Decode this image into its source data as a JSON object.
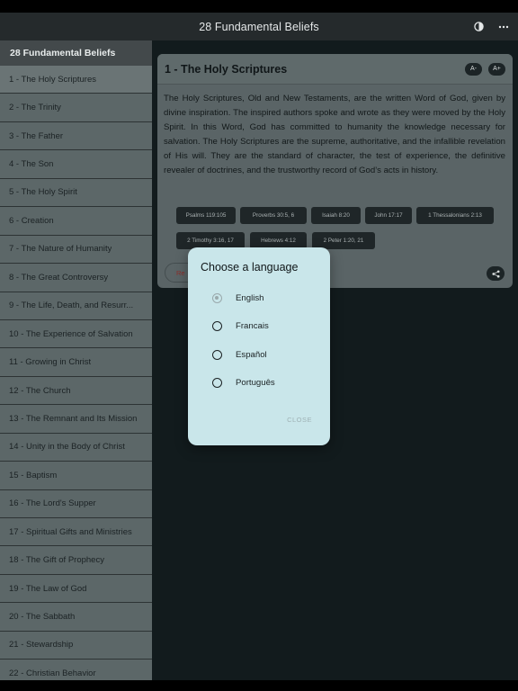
{
  "app_bar": {
    "title": "28 Fundamental Beliefs",
    "actions": [
      {
        "icon": "contrast-icon"
      },
      {
        "icon": "more-vert-icon"
      }
    ]
  },
  "sidebar": {
    "header": "28 Fundamental Beliefs",
    "items": [
      {
        "label": "1 - The Holy Scriptures"
      },
      {
        "label": "2 - The Trinity"
      },
      {
        "label": "3 - The Father"
      },
      {
        "label": "4 - The Son"
      },
      {
        "label": "5 - The Holy Spirit"
      },
      {
        "label": "6 - Creation"
      },
      {
        "label": "7 - The Nature of Humanity"
      },
      {
        "label": "8 - The Great Controversy"
      },
      {
        "label": "9 - The Life, Death, and Resurr..."
      },
      {
        "label": "10 - The Experience of Salvation"
      },
      {
        "label": "11 - Growing in Christ"
      },
      {
        "label": "12 - The Church"
      },
      {
        "label": "13 - The Remnant and Its Mission"
      },
      {
        "label": "14 - Unity in the Body of Christ"
      },
      {
        "label": "15 - Baptism"
      },
      {
        "label": "16 - The Lord's Supper"
      },
      {
        "label": "17 - Spiritual Gifts and Ministries"
      },
      {
        "label": "18 - The Gift of Prophecy"
      },
      {
        "label": "19 - The Law of God"
      },
      {
        "label": "20 - The Sabbath"
      },
      {
        "label": "21 - Stewardship"
      },
      {
        "label": "22 - Christian Behavior"
      }
    ]
  },
  "card": {
    "title": "1 - The Holy Scriptures",
    "font_decrease": "A-",
    "font_increase": "A+",
    "body": "The Holy Scriptures, Old and New Testaments, are the written Word of God, given by divine inspiration. The inspired authors spoke and wrote as they were moved by the Holy Spirit. In this Word, God has committed to humanity the knowledge necessary for salvation. The Holy Scriptures are the supreme, authoritative, and the infallible revelation of His will. They are the standard of character, the test of experience, the definitive revealer of doctrines, and the trustworthy record of God’s acts in history.",
    "references": [
      "Psalms 119:105",
      "Proverbs 30:5, 6",
      "Isaiah 8:20",
      "John 17:17",
      "1 Thessalonians 2:13",
      "2 Timothy 3:16, 17",
      "Hebrews 4:12",
      "2 Peter 1:20, 21"
    ],
    "read_button": "Re"
  },
  "dialog": {
    "title": "Choose a language",
    "options": [
      {
        "label": "English",
        "selected": true
      },
      {
        "label": "Francais",
        "selected": false
      },
      {
        "label": "Español",
        "selected": false
      },
      {
        "label": "Português",
        "selected": false
      }
    ],
    "close_label": "CLOSE"
  }
}
